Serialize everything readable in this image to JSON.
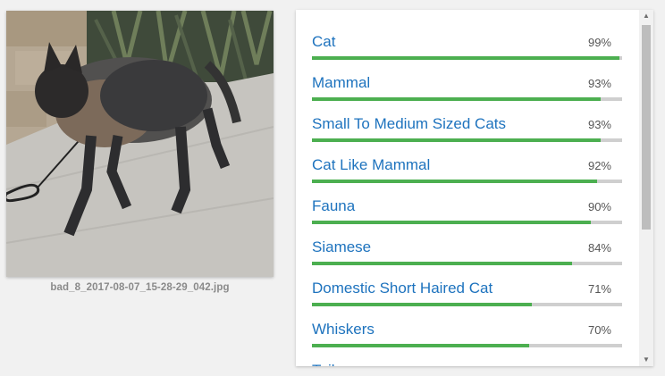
{
  "image": {
    "filename": "bad_8_2017-08-07_15-28-29_042.jpg",
    "subject_icon": "cat-photo"
  },
  "labels": [
    {
      "name": "Cat",
      "score": "99%",
      "fraction": 0.99
    },
    {
      "name": "Mammal",
      "score": "93%",
      "fraction": 0.93
    },
    {
      "name": "Small To Medium Sized Cats",
      "score": "93%",
      "fraction": 0.93
    },
    {
      "name": "Cat Like Mammal",
      "score": "92%",
      "fraction": 0.92
    },
    {
      "name": "Fauna",
      "score": "90%",
      "fraction": 0.9
    },
    {
      "name": "Siamese",
      "score": "84%",
      "fraction": 0.84
    },
    {
      "name": "Domestic Short Haired Cat",
      "score": "71%",
      "fraction": 0.71
    },
    {
      "name": "Whiskers",
      "score": "70%",
      "fraction": 0.7
    },
    {
      "name": "Tail",
      "score": "",
      "fraction": 0
    }
  ],
  "colors": {
    "label_text": "#1e73be",
    "bar_fill": "#4caf50",
    "bar_track": "#cfcfcf"
  },
  "scrollbar": {
    "up_icon": "triangle-up",
    "down_icon": "triangle-down"
  }
}
